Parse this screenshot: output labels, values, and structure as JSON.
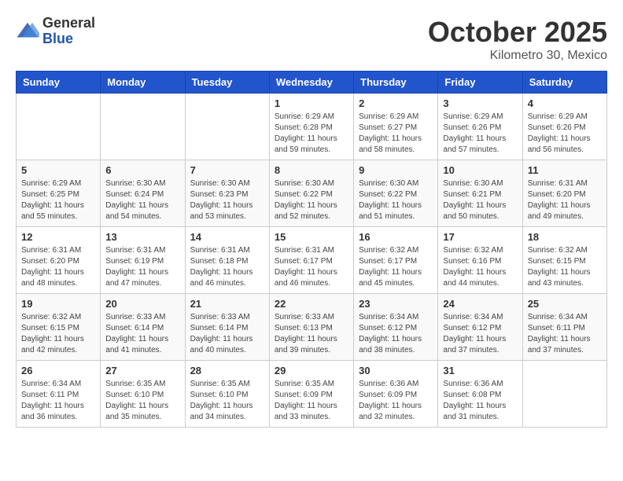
{
  "logo": {
    "general": "General",
    "blue": "Blue"
  },
  "header": {
    "month": "October 2025",
    "location": "Kilometro 30, Mexico"
  },
  "days_of_week": [
    "Sunday",
    "Monday",
    "Tuesday",
    "Wednesday",
    "Thursday",
    "Friday",
    "Saturday"
  ],
  "weeks": [
    [
      {
        "day": "",
        "info": ""
      },
      {
        "day": "",
        "info": ""
      },
      {
        "day": "",
        "info": ""
      },
      {
        "day": "1",
        "info": "Sunrise: 6:29 AM\nSunset: 6:28 PM\nDaylight: 11 hours\nand 59 minutes."
      },
      {
        "day": "2",
        "info": "Sunrise: 6:29 AM\nSunset: 6:27 PM\nDaylight: 11 hours\nand 58 minutes."
      },
      {
        "day": "3",
        "info": "Sunrise: 6:29 AM\nSunset: 6:26 PM\nDaylight: 11 hours\nand 57 minutes."
      },
      {
        "day": "4",
        "info": "Sunrise: 6:29 AM\nSunset: 6:26 PM\nDaylight: 11 hours\nand 56 minutes."
      }
    ],
    [
      {
        "day": "5",
        "info": "Sunrise: 6:29 AM\nSunset: 6:25 PM\nDaylight: 11 hours\nand 55 minutes."
      },
      {
        "day": "6",
        "info": "Sunrise: 6:30 AM\nSunset: 6:24 PM\nDaylight: 11 hours\nand 54 minutes."
      },
      {
        "day": "7",
        "info": "Sunrise: 6:30 AM\nSunset: 6:23 PM\nDaylight: 11 hours\nand 53 minutes."
      },
      {
        "day": "8",
        "info": "Sunrise: 6:30 AM\nSunset: 6:22 PM\nDaylight: 11 hours\nand 52 minutes."
      },
      {
        "day": "9",
        "info": "Sunrise: 6:30 AM\nSunset: 6:22 PM\nDaylight: 11 hours\nand 51 minutes."
      },
      {
        "day": "10",
        "info": "Sunrise: 6:30 AM\nSunset: 6:21 PM\nDaylight: 11 hours\nand 50 minutes."
      },
      {
        "day": "11",
        "info": "Sunrise: 6:31 AM\nSunset: 6:20 PM\nDaylight: 11 hours\nand 49 minutes."
      }
    ],
    [
      {
        "day": "12",
        "info": "Sunrise: 6:31 AM\nSunset: 6:20 PM\nDaylight: 11 hours\nand 48 minutes."
      },
      {
        "day": "13",
        "info": "Sunrise: 6:31 AM\nSunset: 6:19 PM\nDaylight: 11 hours\nand 47 minutes."
      },
      {
        "day": "14",
        "info": "Sunrise: 6:31 AM\nSunset: 6:18 PM\nDaylight: 11 hours\nand 46 minutes."
      },
      {
        "day": "15",
        "info": "Sunrise: 6:31 AM\nSunset: 6:17 PM\nDaylight: 11 hours\nand 46 minutes."
      },
      {
        "day": "16",
        "info": "Sunrise: 6:32 AM\nSunset: 6:17 PM\nDaylight: 11 hours\nand 45 minutes."
      },
      {
        "day": "17",
        "info": "Sunrise: 6:32 AM\nSunset: 6:16 PM\nDaylight: 11 hours\nand 44 minutes."
      },
      {
        "day": "18",
        "info": "Sunrise: 6:32 AM\nSunset: 6:15 PM\nDaylight: 11 hours\nand 43 minutes."
      }
    ],
    [
      {
        "day": "19",
        "info": "Sunrise: 6:32 AM\nSunset: 6:15 PM\nDaylight: 11 hours\nand 42 minutes."
      },
      {
        "day": "20",
        "info": "Sunrise: 6:33 AM\nSunset: 6:14 PM\nDaylight: 11 hours\nand 41 minutes."
      },
      {
        "day": "21",
        "info": "Sunrise: 6:33 AM\nSunset: 6:14 PM\nDaylight: 11 hours\nand 40 minutes."
      },
      {
        "day": "22",
        "info": "Sunrise: 6:33 AM\nSunset: 6:13 PM\nDaylight: 11 hours\nand 39 minutes."
      },
      {
        "day": "23",
        "info": "Sunrise: 6:34 AM\nSunset: 6:12 PM\nDaylight: 11 hours\nand 38 minutes."
      },
      {
        "day": "24",
        "info": "Sunrise: 6:34 AM\nSunset: 6:12 PM\nDaylight: 11 hours\nand 37 minutes."
      },
      {
        "day": "25",
        "info": "Sunrise: 6:34 AM\nSunset: 6:11 PM\nDaylight: 11 hours\nand 37 minutes."
      }
    ],
    [
      {
        "day": "26",
        "info": "Sunrise: 6:34 AM\nSunset: 6:11 PM\nDaylight: 11 hours\nand 36 minutes."
      },
      {
        "day": "27",
        "info": "Sunrise: 6:35 AM\nSunset: 6:10 PM\nDaylight: 11 hours\nand 35 minutes."
      },
      {
        "day": "28",
        "info": "Sunrise: 6:35 AM\nSunset: 6:10 PM\nDaylight: 11 hours\nand 34 minutes."
      },
      {
        "day": "29",
        "info": "Sunrise: 6:35 AM\nSunset: 6:09 PM\nDaylight: 11 hours\nand 33 minutes."
      },
      {
        "day": "30",
        "info": "Sunrise: 6:36 AM\nSunset: 6:09 PM\nDaylight: 11 hours\nand 32 minutes."
      },
      {
        "day": "31",
        "info": "Sunrise: 6:36 AM\nSunset: 6:08 PM\nDaylight: 11 hours\nand 31 minutes."
      },
      {
        "day": "",
        "info": ""
      }
    ]
  ]
}
